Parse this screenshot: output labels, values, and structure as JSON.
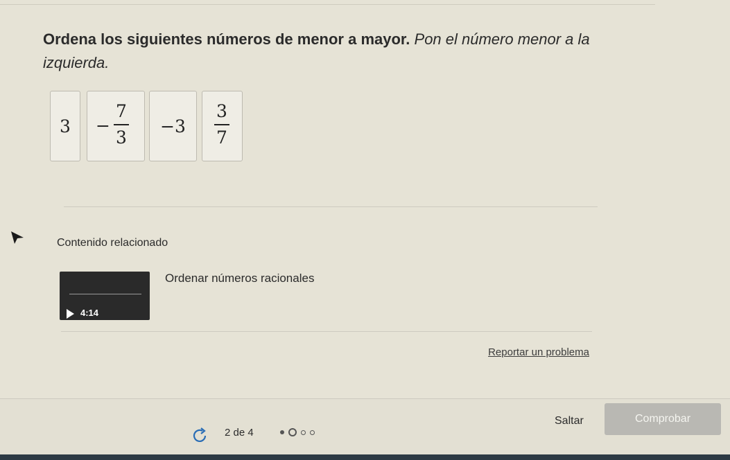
{
  "prompt": {
    "bold_text": "Ordena los siguientes números de menor a mayor.",
    "italic_text": "Pon el número menor a la izquierda."
  },
  "tiles": [
    {
      "kind": "integer",
      "value": "3"
    },
    {
      "kind": "fraction",
      "sign": "−",
      "numerator": "7",
      "denominator": "3"
    },
    {
      "kind": "integer",
      "value": "−3"
    },
    {
      "kind": "fraction",
      "sign": "",
      "numerator": "3",
      "denominator": "7"
    }
  ],
  "related": {
    "heading": "Contenido relacionado",
    "video_title": "Ordenar números racionales",
    "video_duration": "4:14"
  },
  "report_link": "Reportar un problema",
  "footer": {
    "progress_text": "2 de 4",
    "skip_label": "Saltar",
    "check_label": "Comprobar"
  }
}
